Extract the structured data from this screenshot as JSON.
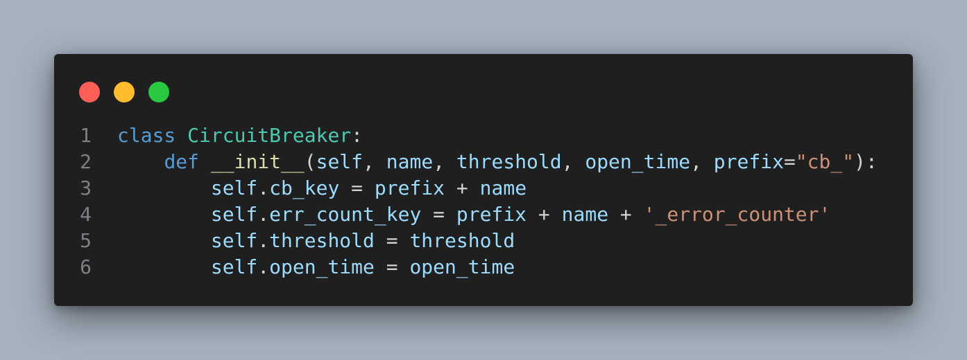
{
  "window": {
    "controls": [
      {
        "name": "close",
        "color": "#ff5f57"
      },
      {
        "name": "minimize",
        "color": "#febc2e"
      },
      {
        "name": "maximize",
        "color": "#28c840"
      }
    ]
  },
  "theme": {
    "keyword": "#569cd6",
    "class_name": "#4ec9b0",
    "function_name": "#dcdcaa",
    "variable": "#9cdcfe",
    "string": "#ce9178",
    "punctuation": "#d4d4d4",
    "line_number": "#7c8088"
  },
  "code": {
    "lines": [
      {
        "number": "1",
        "tokens": [
          {
            "text": "class",
            "kind": "keyword"
          },
          {
            "text": " ",
            "kind": "punctuation"
          },
          {
            "text": "CircuitBreaker",
            "kind": "class_name"
          },
          {
            "text": ":",
            "kind": "punctuation"
          }
        ]
      },
      {
        "number": "2",
        "tokens": [
          {
            "text": "    ",
            "kind": "punctuation"
          },
          {
            "text": "def",
            "kind": "keyword"
          },
          {
            "text": " ",
            "kind": "punctuation"
          },
          {
            "text": "__init__",
            "kind": "function_name"
          },
          {
            "text": "(",
            "kind": "punctuation"
          },
          {
            "text": "self",
            "kind": "variable"
          },
          {
            "text": ", ",
            "kind": "punctuation"
          },
          {
            "text": "name",
            "kind": "variable"
          },
          {
            "text": ", ",
            "kind": "punctuation"
          },
          {
            "text": "threshold",
            "kind": "variable"
          },
          {
            "text": ", ",
            "kind": "punctuation"
          },
          {
            "text": "open_time",
            "kind": "variable"
          },
          {
            "text": ", ",
            "kind": "punctuation"
          },
          {
            "text": "prefix",
            "kind": "variable"
          },
          {
            "text": "=",
            "kind": "punctuation"
          },
          {
            "text": "\"cb_\"",
            "kind": "string"
          },
          {
            "text": "):",
            "kind": "punctuation"
          }
        ]
      },
      {
        "number": "3",
        "tokens": [
          {
            "text": "        ",
            "kind": "punctuation"
          },
          {
            "text": "self",
            "kind": "variable"
          },
          {
            "text": ".",
            "kind": "punctuation"
          },
          {
            "text": "cb_key",
            "kind": "variable"
          },
          {
            "text": " = ",
            "kind": "punctuation"
          },
          {
            "text": "prefix",
            "kind": "variable"
          },
          {
            "text": " + ",
            "kind": "punctuation"
          },
          {
            "text": "name",
            "kind": "variable"
          }
        ]
      },
      {
        "number": "4",
        "tokens": [
          {
            "text": "        ",
            "kind": "punctuation"
          },
          {
            "text": "self",
            "kind": "variable"
          },
          {
            "text": ".",
            "kind": "punctuation"
          },
          {
            "text": "err_count_key",
            "kind": "variable"
          },
          {
            "text": " = ",
            "kind": "punctuation"
          },
          {
            "text": "prefix",
            "kind": "variable"
          },
          {
            "text": " + ",
            "kind": "punctuation"
          },
          {
            "text": "name",
            "kind": "variable"
          },
          {
            "text": " + ",
            "kind": "punctuation"
          },
          {
            "text": "'_error_counter'",
            "kind": "string"
          }
        ]
      },
      {
        "number": "5",
        "tokens": [
          {
            "text": "        ",
            "kind": "punctuation"
          },
          {
            "text": "self",
            "kind": "variable"
          },
          {
            "text": ".",
            "kind": "punctuation"
          },
          {
            "text": "threshold",
            "kind": "variable"
          },
          {
            "text": " = ",
            "kind": "punctuation"
          },
          {
            "text": "threshold",
            "kind": "variable"
          }
        ]
      },
      {
        "number": "6",
        "tokens": [
          {
            "text": "        ",
            "kind": "punctuation"
          },
          {
            "text": "self",
            "kind": "variable"
          },
          {
            "text": ".",
            "kind": "punctuation"
          },
          {
            "text": "open_time",
            "kind": "variable"
          },
          {
            "text": " = ",
            "kind": "punctuation"
          },
          {
            "text": "open_time",
            "kind": "variable"
          }
        ]
      }
    ]
  }
}
